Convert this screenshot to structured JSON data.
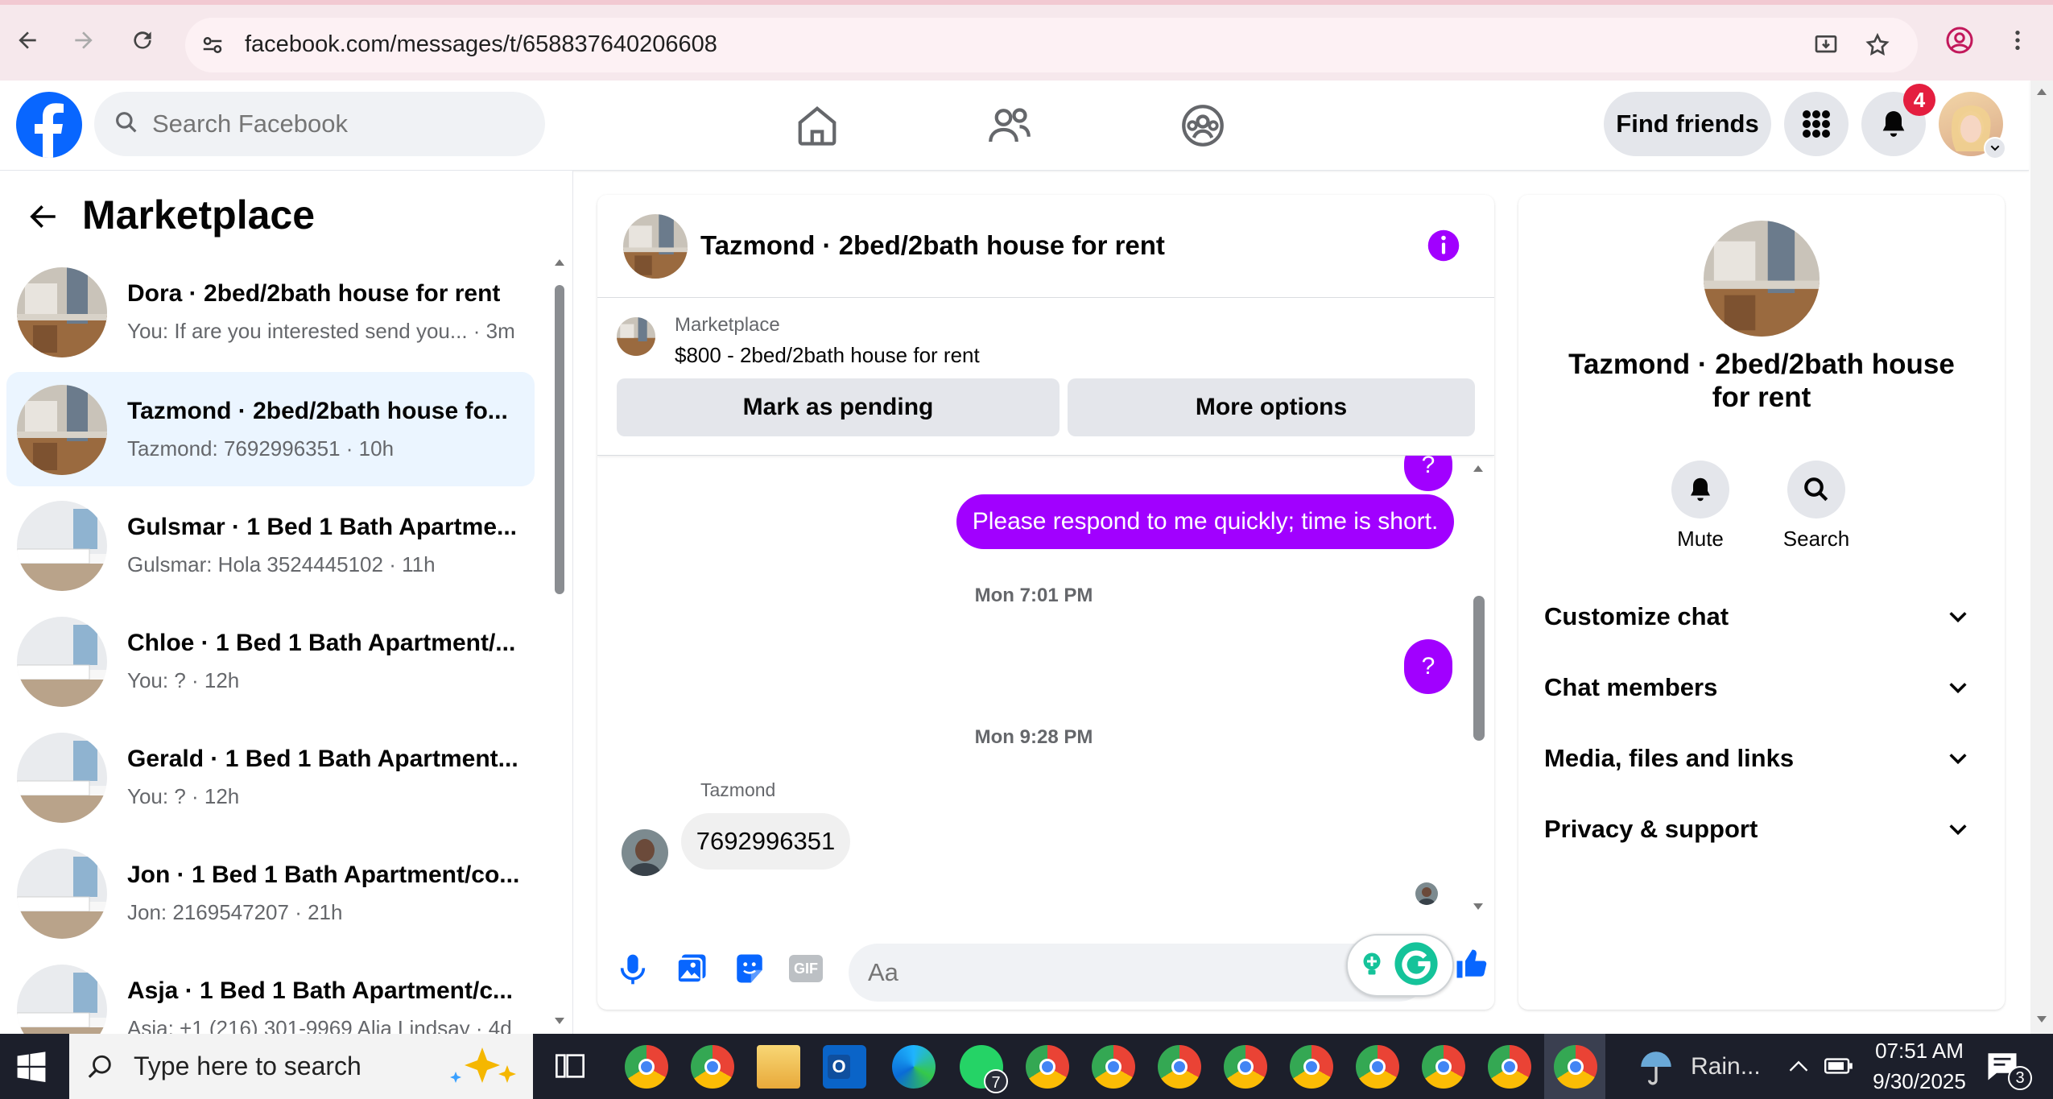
{
  "browser": {
    "url": "facebook.com/messages/t/658837640206608"
  },
  "header": {
    "search_placeholder": "Search Facebook",
    "find_friends": "Find friends",
    "notification_count": "4"
  },
  "sidebar": {
    "title": "Marketplace",
    "conversations": [
      {
        "name": "Dora · 2bed/2bath house for rent",
        "preview": "You: If are you interested send you... · 3m",
        "thumb": "kitchen"
      },
      {
        "name": "Tazmond · 2bed/2bath house fo...",
        "preview": "Tazmond: 7692996351 · 10h",
        "thumb": "kitchen"
      },
      {
        "name": "Gulsmar · 1 Bed 1 Bath Apartme...",
        "preview": "Gulsmar: Hola 3524445102 · 11h",
        "thumb": "bedroom"
      },
      {
        "name": "Chloe · 1 Bed 1 Bath Apartment/...",
        "preview": "You: ? · 12h",
        "thumb": "bedroom"
      },
      {
        "name": "Gerald · 1 Bed 1 Bath Apartment...",
        "preview": "You: ? · 12h",
        "thumb": "bedroom"
      },
      {
        "name": "Jon · 1 Bed 1 Bath Apartment/co...",
        "preview": "Jon: 2169547207 · 21h",
        "thumb": "bedroom"
      },
      {
        "name": "Asja · 1 Bed 1 Bath Apartment/c...",
        "preview": "Asja: +1 (216) 301-9969 Alia Lindsay · 4d",
        "thumb": "bedroom"
      }
    ]
  },
  "chat": {
    "title": "Tazmond · 2bed/2bath house for rent",
    "listing_label": "Marketplace",
    "listing_detail": "$800 - 2bed/2bath house for rent",
    "mark_pending": "Mark as pending",
    "more_options": "More options",
    "msg_question_top": "?",
    "msg_respond": "Please respond to me quickly; time is short.",
    "ts1": "Mon 7:01 PM",
    "msg_question2": "?",
    "ts2": "Mon 9:28 PM",
    "sender_name": "Tazmond",
    "msg_incoming": "7692996351",
    "composer_placeholder": "Aa",
    "gif_label": "GIF"
  },
  "details": {
    "title": "Tazmond · 2bed/2bath house for rent",
    "mute": "Mute",
    "search": "Search",
    "sections": [
      "Customize chat",
      "Chat members",
      "Media, files and links",
      "Privacy & support"
    ]
  },
  "taskbar": {
    "search_placeholder": "Type here to search",
    "weather": "Rain...",
    "time": "07:51 AM",
    "date": "9/30/2025",
    "notif_count": "3",
    "whatsapp_badge": "7"
  },
  "colors": {
    "fb_blue": "#0866ff",
    "accent_purple": "#a100ff",
    "notification_red": "#e41e3f"
  }
}
